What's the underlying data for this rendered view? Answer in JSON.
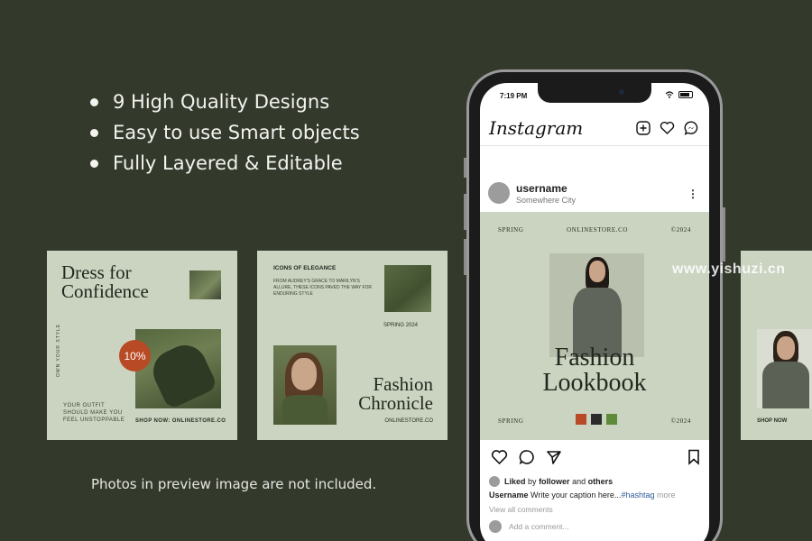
{
  "features": [
    "9 High Quality Designs",
    "Easy to use Smart objects",
    "Fully Layered & Editable"
  ],
  "disclaimer": "Photos in preview image are not included.",
  "watermark": "www.yishuzi.cn",
  "card1": {
    "title_line1": "Dress for",
    "title_line2": "Confidence",
    "badge": "10%",
    "vertical_text": "OWN YOUR STYLE",
    "tagline": [
      "YOUR OUTFIT",
      "SHOULD MAKE YOU",
      "FEEL UNSTOPPABLE"
    ],
    "shop": "SHOP NOW: ONLINESTORE.CO"
  },
  "card2": {
    "heading": "ICONS OF ELEGANCE",
    "body": "FROM AUDREY'S GRACE TO MARILYN'S ALLURE, THESE ICONS PAVED THE WAY FOR ENDURING STYLE",
    "season": "SPRING 2024",
    "title_line1": "Fashion",
    "title_line2": "Chronicle",
    "site": "ONLINESTORE.CO"
  },
  "card3": {
    "shop": "SHOP NOW"
  },
  "phone": {
    "time": "7:19 PM",
    "app_name": "Instagram",
    "username": "username",
    "location": "Somewhere City",
    "post": {
      "top_left": "SPRING",
      "top_center": "ONLINESTORE.CO",
      "top_right": "©2024",
      "title_line1": "Fashion",
      "title_line2": "Lookbook",
      "bottom_left": "SPRING",
      "bottom_right": "©2024",
      "swatch_colors": [
        "#b84a25",
        "#2b2b2b",
        "#5f8a3a"
      ]
    },
    "likes_prefix": "Liked",
    "likes_by": "by",
    "likes_user": "follower",
    "likes_and": "and",
    "likes_others": "others",
    "caption_user": "Username",
    "caption_text": "Write your caption here...",
    "caption_hashtag": "#hashtag",
    "caption_more": "more",
    "view_comments": "View all comments",
    "add_comment": "Add a comment..."
  }
}
